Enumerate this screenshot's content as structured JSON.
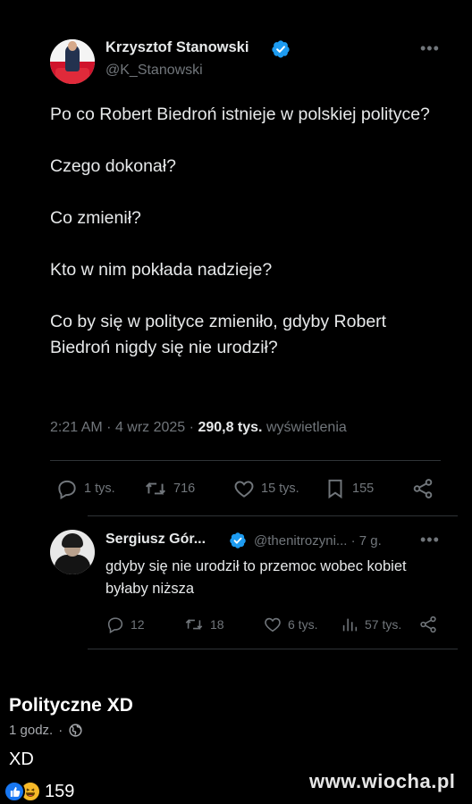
{
  "tweet": {
    "author_name": "Krzysztof Stanowski",
    "handle": "@K_Stanowski",
    "more_icon": "•••",
    "body": "Po co Robert Biedroń istnieje w polskiej polityce?\n\nCzego dokonał?\n\nCo zmienił?\n\nKto w nim pokłada nadzieje?\n\nCo by się w polityce zmieniło, gdyby Robert Biedroń nigdy się nie urodził?",
    "time": "2:21 AM",
    "date": "4 wrz 2025",
    "views_count": "290,8 tys.",
    "views_label": "wyświetlenia",
    "actions": {
      "replies": "1 tys.",
      "retweets": "716",
      "likes": "15 tys.",
      "bookmarks": "155"
    }
  },
  "reply": {
    "author_name": "Sergiusz Gór...",
    "handle": "@thenitrozyni... · 7 g.",
    "more_icon": "•••",
    "text": "gdyby się nie urodził to przemoc wobec kobiet byłaby niższa",
    "actions": {
      "replies": "12",
      "retweets": "18",
      "likes": "6 tys.",
      "views": "57 tys."
    }
  },
  "post": {
    "title": "Polityczne XD",
    "time": "1 godz.",
    "dot": "·",
    "caption": "XD",
    "reaction_count": "159"
  },
  "watermark": "www.wiocha.pl",
  "colors": {
    "background": "#000000",
    "text": "#e7e9ea",
    "muted": "#71767b",
    "verified": "#1d9bf0",
    "like_react": "#1877f2",
    "haha_react": "#f7b928"
  },
  "icons": [
    "verified-badge-icon",
    "more-icon",
    "reply-icon",
    "retweet-icon",
    "like-icon",
    "bookmark-icon",
    "share-icon",
    "views-icon",
    "globe-icon",
    "like-reaction-icon",
    "haha-reaction-icon"
  ]
}
